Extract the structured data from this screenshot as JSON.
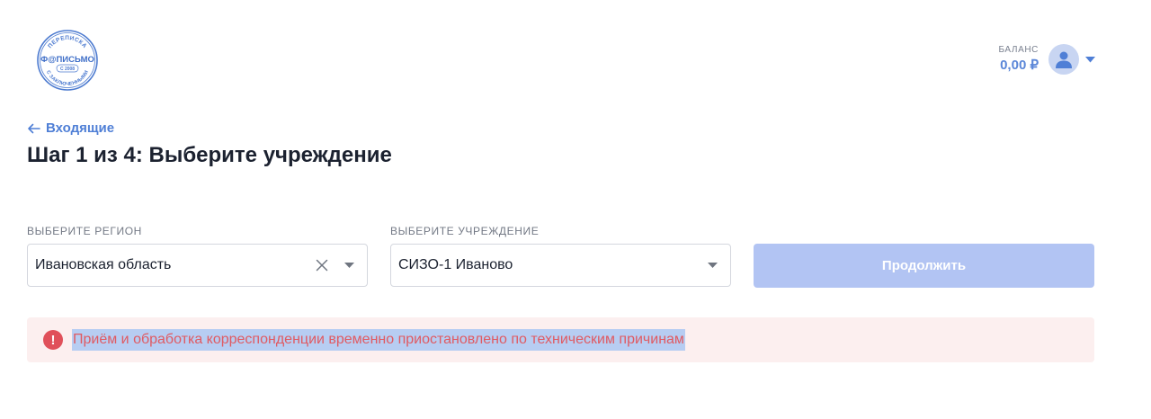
{
  "logo": {
    "top_text": "ПЕРЕПИСКА",
    "brand_text": "Ф@ПИСЬМО",
    "since_text": "С 2008",
    "bottom_text": "С ЗАКЛЮЧЕННЫМИ"
  },
  "account": {
    "balance_label": "БАЛАНС",
    "balance_value": "0,00 ₽"
  },
  "nav": {
    "back_label": "Входящие"
  },
  "page": {
    "title": "Шаг 1 из 4: Выберите учреждение"
  },
  "form": {
    "region": {
      "label": "ВЫБЕРИТЕ РЕГИОН",
      "value": "Ивановская область"
    },
    "institution": {
      "label": "ВЫБЕРИТЕ УЧРЕЖДЕНИЕ",
      "value": "СИЗО-1 Иваново"
    },
    "continue_label": "Продолжить"
  },
  "alert": {
    "icon": "!",
    "text": "Приём и обработка корреспонденции временно приостановлено по техническим причинам"
  },
  "colors": {
    "accent": "#4f7fd6",
    "button_disabled": "#b2c4f3",
    "alert_bg": "#fcefef",
    "alert_text": "#e05a62",
    "selection": "#b7cdf2"
  }
}
